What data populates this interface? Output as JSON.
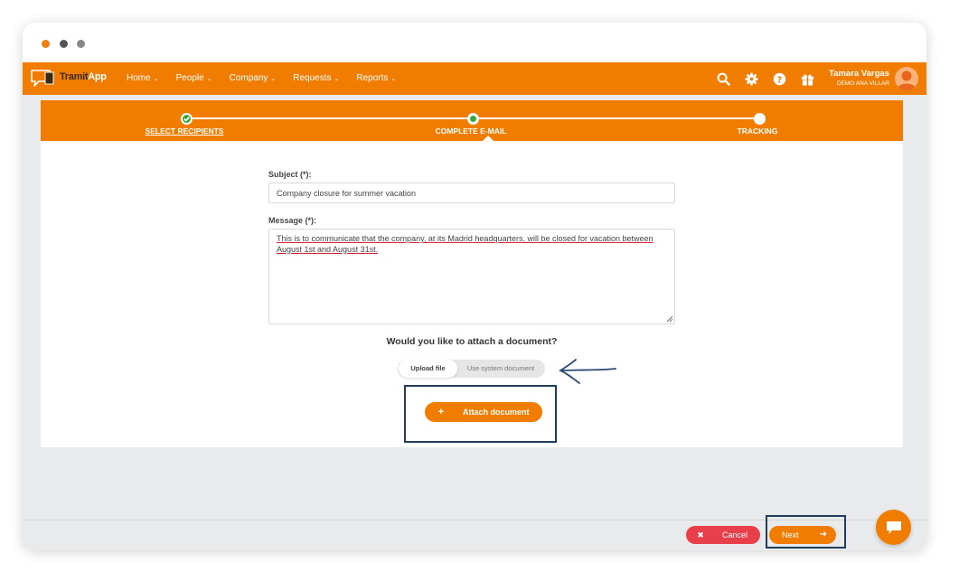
{
  "window_controls": [
    "close",
    "minimize",
    "maximize"
  ],
  "brand": {
    "name_part1": "Tramit",
    "name_part2": "App"
  },
  "nav": {
    "items": [
      {
        "label": "Home"
      },
      {
        "label": "People"
      },
      {
        "label": "Company"
      },
      {
        "label": "Requests"
      },
      {
        "label": "Reports"
      }
    ],
    "icons": [
      "search-icon",
      "gear-icon",
      "help-icon",
      "gift-icon"
    ]
  },
  "user": {
    "name": "Tamara Vargas",
    "company": "DEMO ANA VILLAR"
  },
  "stepper": {
    "steps": [
      {
        "label": "SELECT RECIPIENTS",
        "state": "done"
      },
      {
        "label": "COMPLETE E-MAIL",
        "state": "current"
      },
      {
        "label": "TRACKING",
        "state": "pending"
      }
    ]
  },
  "form": {
    "subject_label": "Subject (*):",
    "subject_value": "Company closure for summer vacation",
    "message_label": "Message (*):",
    "message_value": "This is to communicate that the company, at its Madrid headquarters, will be closed for vacation between August 1st and August 31st."
  },
  "attach": {
    "question": "Would you like to attach a document?",
    "toggle_options": [
      {
        "label": "Upload file",
        "active": true
      },
      {
        "label": "Use system document",
        "active": false
      }
    ],
    "button_label": "Attach document",
    "button_icon": "+"
  },
  "footer": {
    "cancel_label": "Cancel",
    "next_label": "Next"
  },
  "colors": {
    "brand_orange": "#f07d00",
    "cancel_red": "#e8404a",
    "success_green": "#3aa53a",
    "annotation_navy": "#1f3d5f"
  }
}
